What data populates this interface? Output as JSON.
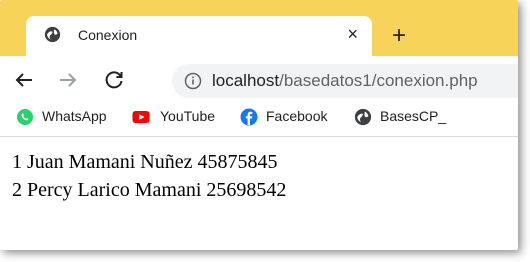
{
  "tab": {
    "title": "Conexion",
    "close": "×",
    "new_tab": "+"
  },
  "toolbar": {
    "back": "←",
    "forward": "→",
    "reload": "C"
  },
  "address": {
    "host": "localhost",
    "path": "/basedatos1/conexion.php"
  },
  "bookmarks": [
    {
      "label": "WhatsApp",
      "icon": "whatsapp-icon",
      "color": "#25d366"
    },
    {
      "label": "YouTube",
      "icon": "youtube-icon",
      "color": "#ff0000"
    },
    {
      "label": "Facebook",
      "icon": "facebook-icon",
      "color": "#1877f2"
    },
    {
      "label": "BasesCP_",
      "icon": "globe-icon",
      "color": "#3c4043"
    }
  ],
  "rows": [
    "1 Juan Mamani Nuñez 45875845",
    "2 Percy Larico Mamani 25698542"
  ],
  "colors": {
    "tabstrip": "#f7d35a",
    "omnibox": "#f1f3f4"
  }
}
